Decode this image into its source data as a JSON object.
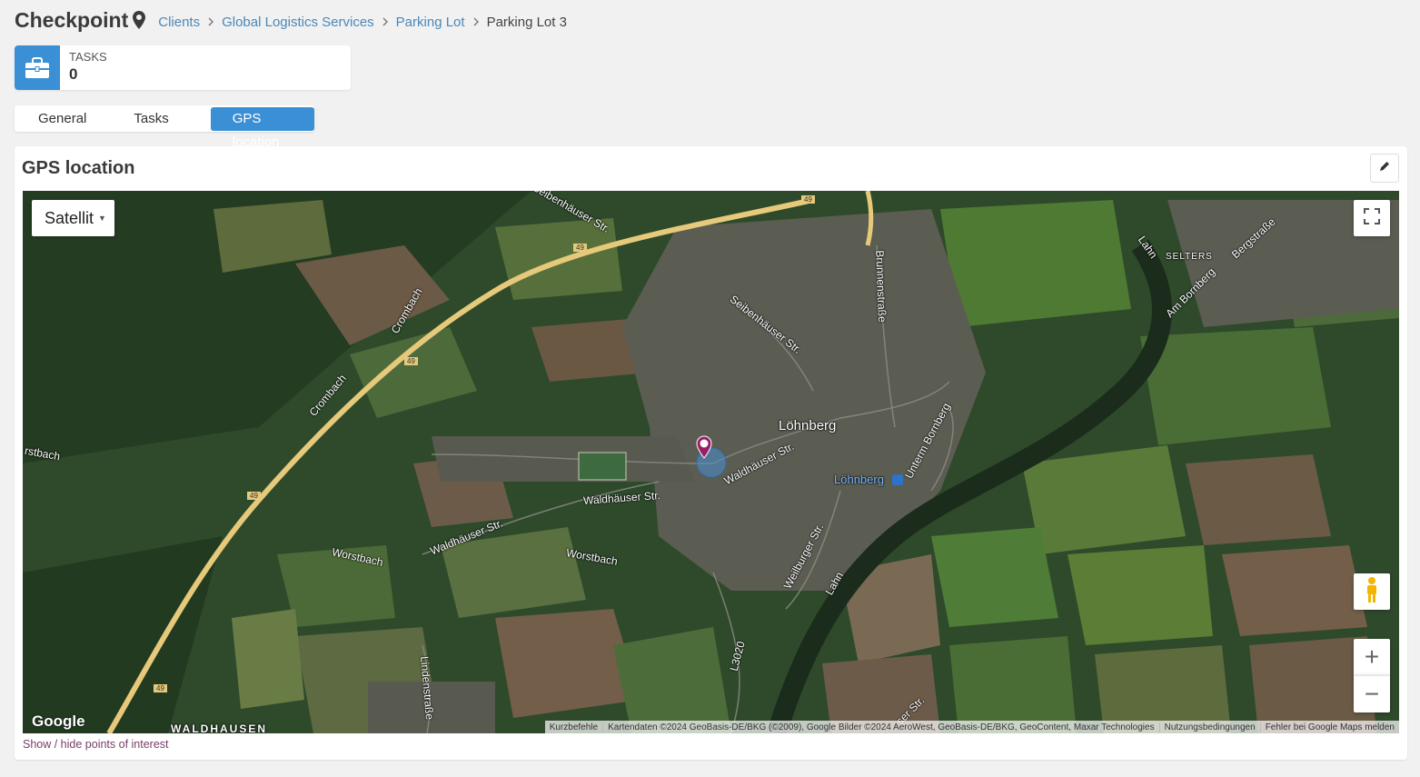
{
  "header": {
    "title": "Checkpoint",
    "breadcrumbs": [
      "Clients",
      "Global Logistics Services",
      "Parking Lot"
    ],
    "current": "Parking Lot 3"
  },
  "tasks_card": {
    "label": "TASKS",
    "count": "0"
  },
  "tabs": [
    "General",
    "Tasks",
    "GPS location"
  ],
  "active_tab": "GPS location",
  "panel": {
    "title": "GPS location"
  },
  "map": {
    "type_selected": "Satellit",
    "google_logo": "Google",
    "attribution": [
      "Kurzbefehle",
      "Kartendaten ©2024 GeoBasis-DE/BKG (©2009), Google Bilder ©2024 AeroWest, GeoBasis-DE/BKG, GeoContent, Maxar Technologies",
      "Nutzungsbedingungen",
      "Fehler bei Google Maps melden"
    ],
    "labels": {
      "town": "Löhnberg",
      "station": "Löhnberg",
      "selters": "SELTERS",
      "waldhausen": "WALDHAUSEN",
      "seibenhauser": "Seibenhäuser Str.",
      "seibenhauser_top": "Seibenhäuser Str.",
      "brunnenstrasse": "Brunnenstraße",
      "waldhauser1": "Waldhäuser Str.",
      "waldhauser2": "Waldhäuser Str.",
      "waldhauser3": "Waldhäuser Str.",
      "unterm_bornberg": "Unterm Bornberg",
      "am_bornberg": "Am Bornberg",
      "bergstrasse": "Bergstraße",
      "weilburger": "Weilburger Str.",
      "lahn1": "Lahn",
      "lahn2": "Lahn",
      "crombach1": "Crombach",
      "crombach2": "Crombach",
      "worstbach1": "Worstbach",
      "worstbach2": "Worstbach",
      "worstbach3": "rstbach",
      "lindenstrasse": "Lindenstraße",
      "l3020": "L3020",
      "sertr": "ser Str.",
      "road49": "49"
    },
    "poi_link": "Show / hide points of interest"
  },
  "colors": {
    "accent": "#3b8fd4",
    "link": "#4a88b9",
    "marker": "#9b1d6a",
    "highway": "#e6c97a"
  }
}
